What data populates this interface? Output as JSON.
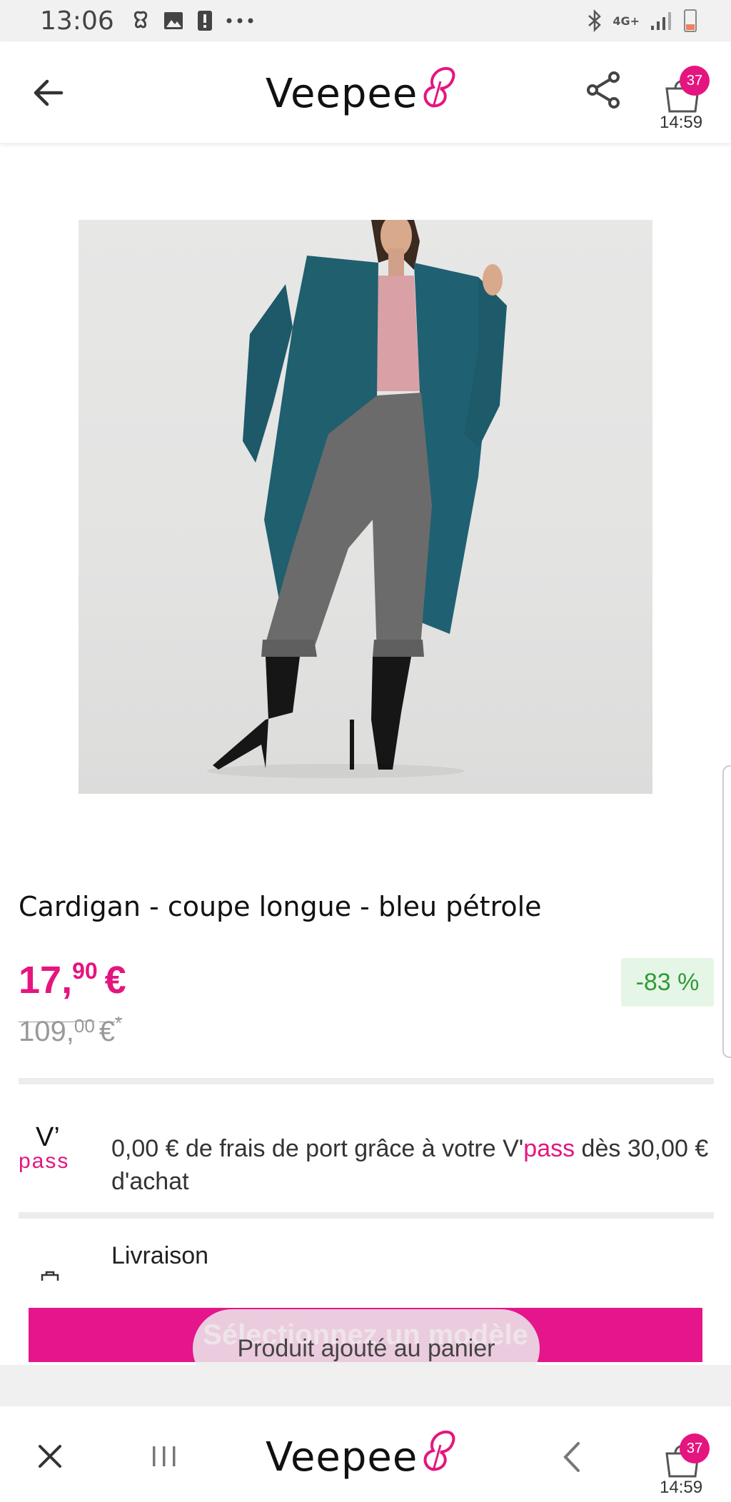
{
  "status_bar": {
    "time": "13:06",
    "left_icons": [
      "butterfly-icon",
      "image-icon",
      "alert-icon",
      "more-icon"
    ],
    "right_icons": [
      "bluetooth-icon",
      "4g-icon",
      "signal-icon",
      "battery-icon"
    ],
    "network": "4G+"
  },
  "header": {
    "logo": "Veepee",
    "cart_count": "37",
    "cart_timer": "14:59"
  },
  "product": {
    "title": "Cardigan - coupe longue - bleu pétrole",
    "price_int": "17,",
    "price_dec": "90",
    "price_currency": "€",
    "old_price_int": "109,",
    "old_price_dec": "00",
    "old_price_currency": "€",
    "old_price_star": "*",
    "discount": "-83 %"
  },
  "vpass": {
    "logo_top": "V’",
    "logo_bottom": "pass",
    "text_part1": "0,00 € de frais de port grâce à votre V'",
    "text_accent": "pass",
    "text_part2": " dès 30,00 € d'achat"
  },
  "delivery": {
    "label": "Livraison"
  },
  "cta": {
    "label": "Sélectionnez un modèle"
  },
  "toast": {
    "message": "Produit ajouté au panier"
  },
  "bottom_bar": {
    "logo": "Veepee",
    "cart_count": "37",
    "cart_timer": "14:59"
  },
  "colors": {
    "brand_pink": "#e5157f",
    "discount_green": "#2e9b3a",
    "discount_bg": "#e6f6e6"
  }
}
